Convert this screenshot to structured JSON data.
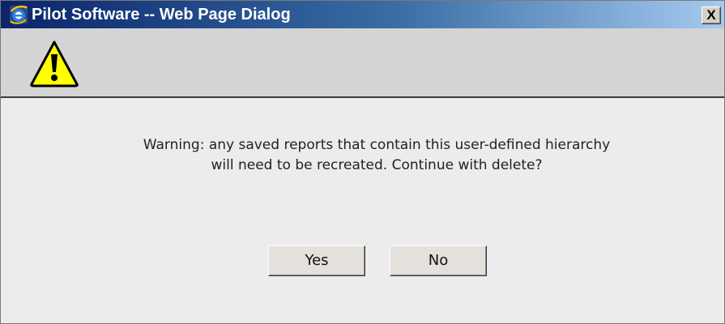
{
  "window": {
    "title": "Pilot Software -- Web Page Dialog",
    "close_label": "X"
  },
  "icons": {
    "title_icon": "internet-explorer-icon",
    "header_icon": "warning-triangle-icon"
  },
  "message": {
    "line1": "Warning: any saved reports that contain this user-defined hierarchy",
    "line2": "will need to be recreated. Continue with delete?"
  },
  "buttons": {
    "yes_label": "Yes",
    "no_label": "No"
  },
  "colors": {
    "titlebar_start": "#0a246a",
    "titlebar_end": "#a6caf0",
    "dialog_bg": "#ececec",
    "header_bg": "#d4d4d4",
    "warning_yellow": "#ffff00"
  }
}
